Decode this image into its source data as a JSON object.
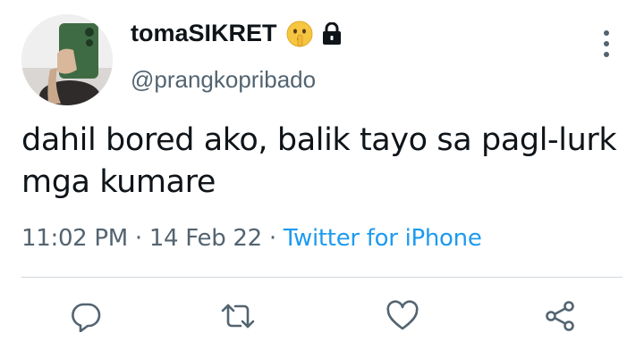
{
  "user": {
    "display_name": "tomaSIKRET",
    "handle": "@prangkopribado",
    "name_emoji": "shushing-face-icon",
    "protected_icon": "lock-icon"
  },
  "tweet": {
    "text": "dahil bored ako, balik tayo sa pagl-lurk mga kumare",
    "time": "11:02 PM",
    "separator": "·",
    "date": "14 Feb 22",
    "source": "Twitter for iPhone"
  },
  "actions": [
    {
      "icon": "reply-icon"
    },
    {
      "icon": "retweet-icon"
    },
    {
      "icon": "like-icon"
    },
    {
      "icon": "share-icon"
    }
  ],
  "colors": {
    "text": "#0f1419",
    "secondary": "#536471",
    "link": "#1d9bf0",
    "divider": "#cfd9de"
  }
}
